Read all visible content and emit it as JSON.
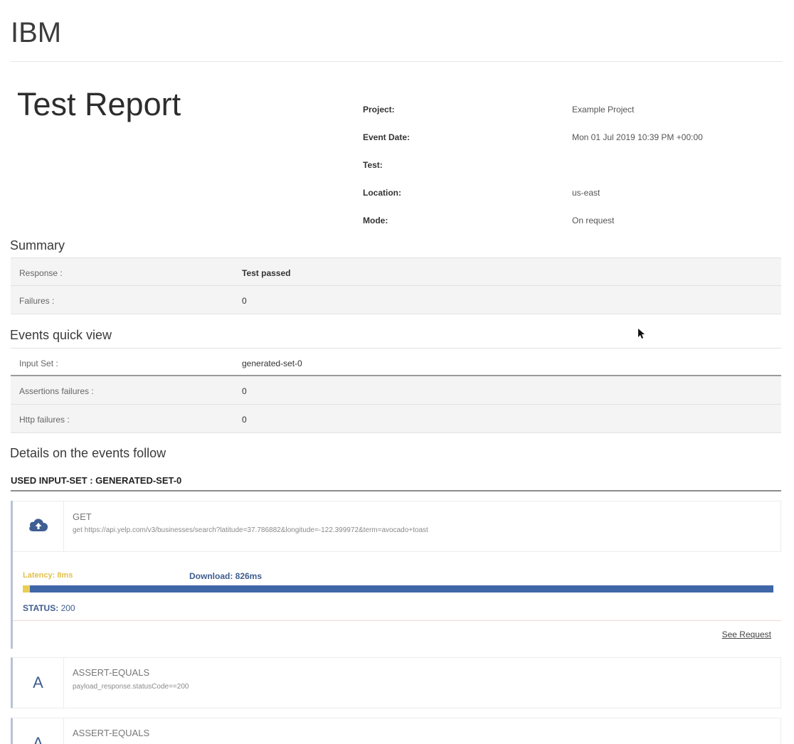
{
  "brand": "IBM",
  "report": {
    "title": "Test Report"
  },
  "meta": [
    {
      "key": "Project:",
      "value": "Example Project"
    },
    {
      "key": "Event Date:",
      "value": "Mon 01 Jul 2019 10:39 PM +00:00"
    },
    {
      "key": "Test:",
      "value": ""
    },
    {
      "key": "Location:",
      "value": "us-east"
    },
    {
      "key": "Mode:",
      "value": "On request"
    }
  ],
  "summary": {
    "title": "Summary",
    "rows": [
      {
        "key": "Response :",
        "value": "Test passed"
      },
      {
        "key": "Failures :",
        "value": "0"
      }
    ]
  },
  "quick_view": {
    "title": "Events quick view",
    "rows": [
      {
        "key": "Input Set :",
        "value": "generated-set-0"
      },
      {
        "key": "Assertions failures :",
        "value": "0"
      },
      {
        "key": "Http failures :",
        "value": "0"
      }
    ]
  },
  "details": {
    "title": "Details on the events follow",
    "used_heading": "USED INPUT-SET : GENERATED-SET-0"
  },
  "request_event": {
    "icon": "cloud-upload-icon",
    "method": "GET",
    "description": "get https://api.yelp.com/v3/businesses/search?latitude=37.786882&longitude=-122.399972&term=avocado+toast",
    "latency_label": "Latency: 8ms",
    "download_label": "Download: 826ms",
    "latency_ms": 8,
    "download_ms": 826,
    "status_key": "STATUS:",
    "status_value": "200",
    "see_request": "See Request",
    "colors": {
      "latency": "#e9cd55",
      "download": "#3f66a8"
    }
  },
  "assertions": [
    {
      "letter": "A",
      "type": "ASSERT-EQUALS",
      "detail": "payload_response.statusCode==200"
    },
    {
      "letter": "A",
      "type": "ASSERT-EQUALS",
      "detail": ""
    }
  ]
}
